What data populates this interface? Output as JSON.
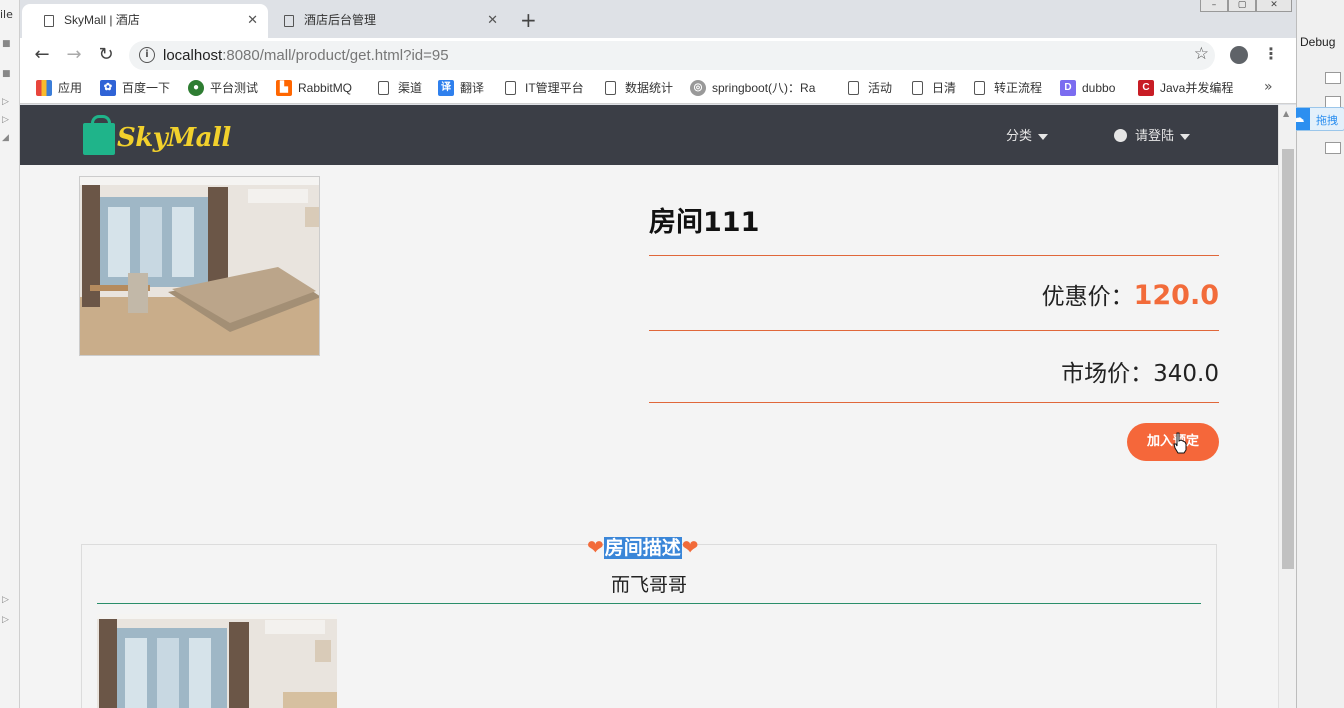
{
  "ide": {
    "left_label": "ile",
    "right_label": "Debug",
    "right_pill_label": "拖拽"
  },
  "tabs": [
    {
      "title": "SkyMall | 酒店",
      "active": true
    },
    {
      "title": "酒店后台管理",
      "active": false
    }
  ],
  "toolbar": {
    "url_host": "localhost",
    "url_rest": ":8080/mall/product/get.html?id=95"
  },
  "bookmarks": [
    {
      "label": "应用",
      "icon": "apps-grid-icon"
    },
    {
      "label": "百度一下",
      "icon": "baidu-paw-icon"
    },
    {
      "label": "平台测试",
      "icon": "globe-icon"
    },
    {
      "label": "RabbitMQ",
      "icon": "rabbitmq-icon"
    },
    {
      "label": "渠道",
      "icon": "page-icon"
    },
    {
      "label": "翻译",
      "icon": "translate-icon"
    },
    {
      "label": "IT管理平台",
      "icon": "page-icon"
    },
    {
      "label": "数据统计",
      "icon": "page-icon"
    },
    {
      "label": "springboot(八)：Ra",
      "icon": "blog-icon"
    },
    {
      "label": "活动",
      "icon": "page-icon"
    },
    {
      "label": "日清",
      "icon": "page-icon"
    },
    {
      "label": "转正流程",
      "icon": "page-icon"
    },
    {
      "label": "dubbo",
      "icon": "dubbo-icon"
    },
    {
      "label": "Java并发编程",
      "icon": "csdn-icon"
    }
  ],
  "navbar": {
    "brand": "SkyMall",
    "category": "分类",
    "login": "请登陆"
  },
  "product": {
    "title": "房间111",
    "discount_label": "优惠价：",
    "discount_value": "120.0",
    "market_label": "市场价：",
    "market_value": "340.0",
    "order_button": "加入预定"
  },
  "description": {
    "heading": "房间描述",
    "subtitle": "而飞哥哥"
  },
  "colors": {
    "accent": "#f5673a",
    "navbar": "#3b3e46",
    "brand": "#f2d12c",
    "divider": "#2a8e6a"
  }
}
